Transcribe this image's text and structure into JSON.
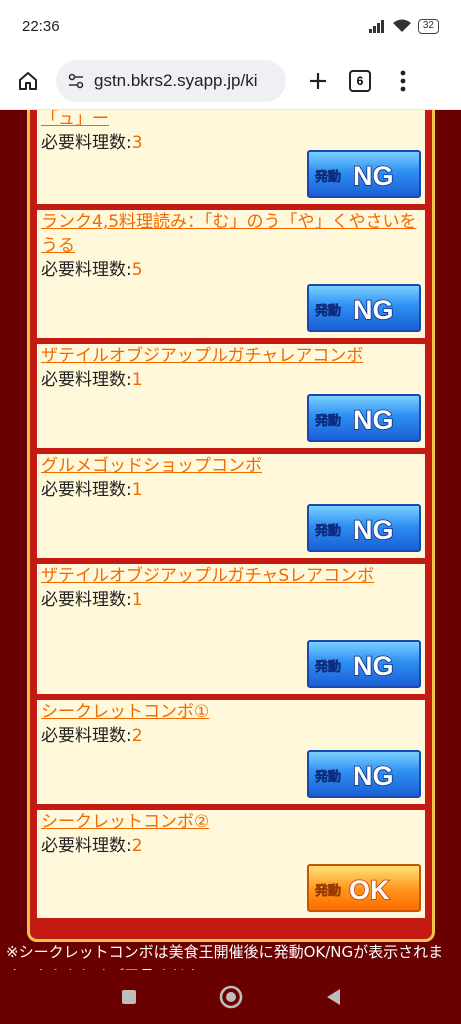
{
  "status_bar": {
    "time": "22:36",
    "battery": "32"
  },
  "browser": {
    "url": "gstn.bkrs2.syapp.jp/ki",
    "tab_count": "6"
  },
  "req_label": "必要料理数:",
  "combos": [
    {
      "title": "「ュ」ー",
      "count": "3",
      "status": "NG"
    },
    {
      "title": "ランク4,5料理読み：「む」のう「や」くやさいをうる",
      "count": "5",
      "status": "NG"
    },
    {
      "title": "ザテイルオブジアップルガチャレアコンボ",
      "count": "1",
      "status": "NG"
    },
    {
      "title": "グルメゴッドショップコンボ",
      "count": "1",
      "status": "NG"
    },
    {
      "title": "ザテイルオブジアップルガチャSレアコンボ",
      "count": "1",
      "status": "NG"
    },
    {
      "title": "シークレットコンボ①",
      "count": "2",
      "status": "NG"
    },
    {
      "title": "シークレットコンボ②",
      "count": "2",
      "status": "OK"
    }
  ],
  "badge_prefix": "発動",
  "note": "※シークレットコンボは美食王開催後に発動OK/NGが表示されます。あらかじめご了承ください。",
  "colors": {
    "background": "#6b0000",
    "card": "#fff8da",
    "link": "#f06a00",
    "ng": "#1a5fd6",
    "ok": "#ff6a00"
  }
}
